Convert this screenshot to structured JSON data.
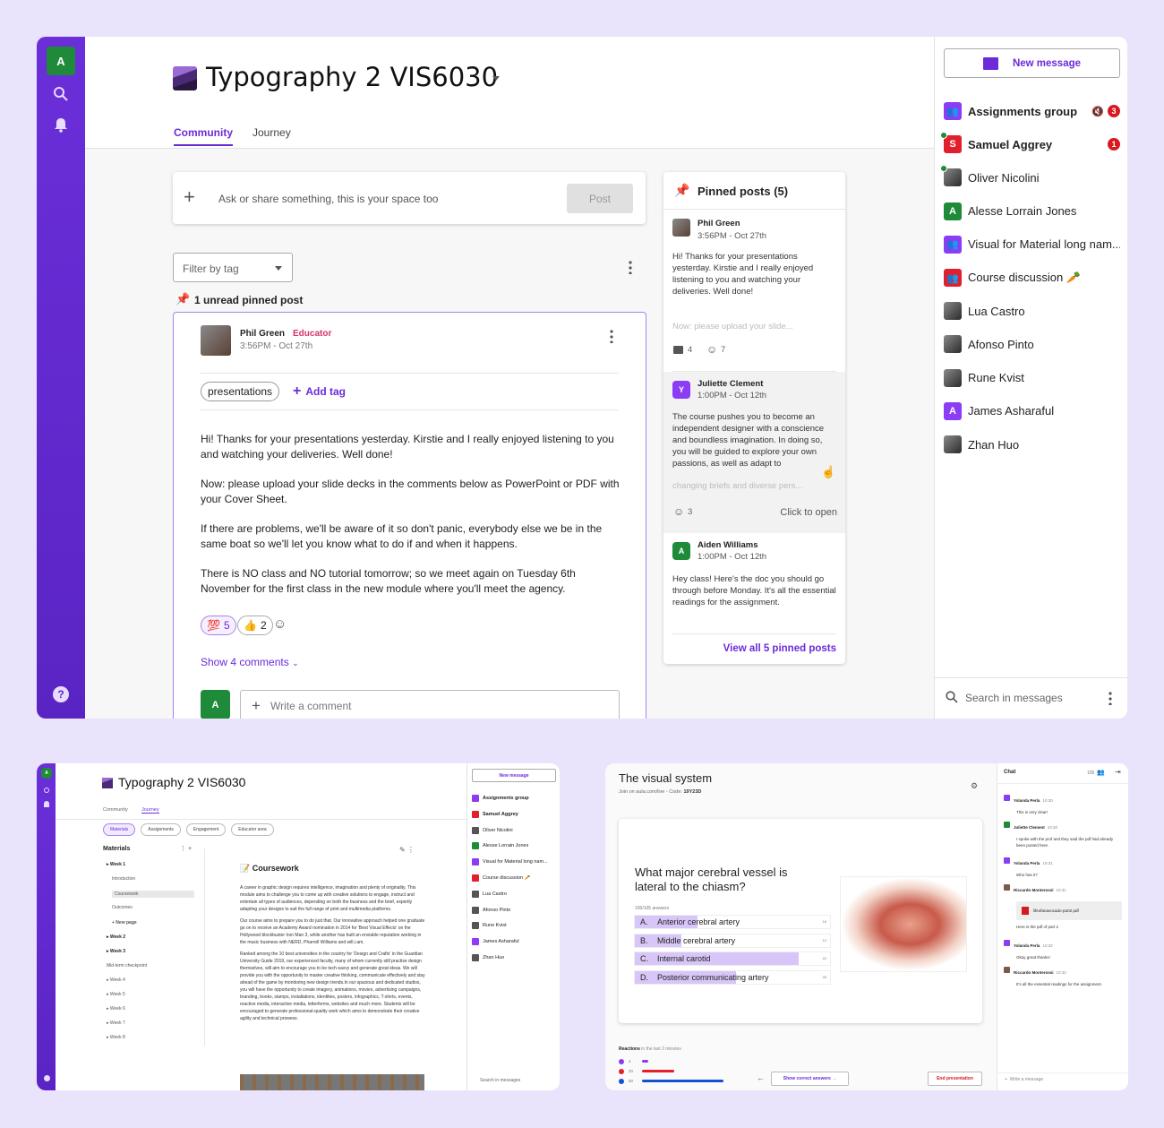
{
  "main": {
    "user_initial": "A",
    "course_title": "Typography 2 VIS6030",
    "tabs": [
      {
        "label": "Community",
        "active": true
      },
      {
        "label": "Journey",
        "active": false
      }
    ],
    "composer": {
      "placeholder": "Ask or share something, this is your space too",
      "post_label": "Post"
    },
    "filter": {
      "placeholder": "Filter by tag"
    },
    "unread_pinned": "1 unread pinned post",
    "post": {
      "author": "Phil Green",
      "role": "Educator",
      "time": "3:56PM - Oct 27th",
      "tags": [
        "presentations"
      ],
      "add_tag": "Add tag",
      "paragraphs": [
        "Hi! Thanks for your presentations yesterday. Kirstie and I really enjoyed listening to you and watching your deliveries. Well done!",
        "Now: please upload your slide decks in the comments below as PowerPoint or PDF with your Cover Sheet.",
        "If there are problems, we'll be aware of it so don't panic, everybody else we be in the same boat so we'll let you know what to do if and when it happens.",
        "There is NO class and NO tutorial tomorrow; so we meet again on Tuesday 6th November for the first class in the new module where you'll meet the agency."
      ],
      "reactions": [
        {
          "emoji": "💯",
          "count": "5"
        },
        {
          "emoji": "👍",
          "count": "2"
        }
      ],
      "show_comments": "Show 4 comments",
      "comment_placeholder": "Write a comment",
      "commenter_initial": "A"
    },
    "pinned": {
      "title": "Pinned posts (5)",
      "items": [
        {
          "author": "Phil Green",
          "time": "3:56PM - Oct 27th",
          "text": "Hi! Thanks for your presentations yesterday. Kirstie and I really enjoyed listening to you and watching your deliveries. Well done!",
          "fade": "Now: please upload your slide...",
          "comments": "4",
          "reactions": "7"
        },
        {
          "author": "Juliette Clement",
          "initial": "Y",
          "time": "1:00PM - Oct 12th",
          "text": "The course pushes you to become an independent designer with a conscience and boundless imagination. In doing so, you will be guided to explore your own passions, as well as adapt to",
          "fade": "changing briefs and diverse pers...",
          "reactions": "3",
          "open": "Click to open"
        },
        {
          "author": "Aiden Williams",
          "initial": "A",
          "time": "1:00PM - Oct 12th",
          "text": "Hey class! Here's the doc you should go through before Monday. It's all the essential readings for the assignment."
        }
      ],
      "view_all": "View all 5 pinned posts"
    }
  },
  "chat": {
    "new_message": "New message",
    "items": [
      {
        "name": "Assignments group",
        "type": "group",
        "color": "#8b3cf5",
        "bold": true,
        "muted": true,
        "badge": "3"
      },
      {
        "name": "Samuel Aggrey",
        "initial": "S",
        "color": "#e0202d",
        "bold": true,
        "online": true,
        "badge": "1"
      },
      {
        "name": "Oliver Nicolini",
        "type": "photo",
        "online": true
      },
      {
        "name": "Alesse Lorrain Jones",
        "initial": "A",
        "color": "#1f8a3a"
      },
      {
        "name": "Visual for Material long nam...",
        "type": "group",
        "color": "#8b3cf5"
      },
      {
        "name": "Course discussion 🥕",
        "type": "group",
        "color": "#e0202d"
      },
      {
        "name": "Lua Castro",
        "type": "photo"
      },
      {
        "name": "Afonso Pinto",
        "type": "photo"
      },
      {
        "name": "Rune Kvist",
        "type": "photo"
      },
      {
        "name": "James Asharaful",
        "initial": "A",
        "color": "#8b3cf5"
      },
      {
        "name": "Zhan Huo",
        "type": "photo"
      }
    ],
    "search_placeholder": "Search in messages"
  },
  "journey": {
    "title": "Typography 2 VIS6030",
    "tabs": [
      "Community",
      "Journey"
    ],
    "chips": [
      "Materials",
      "Assignments",
      "Engagement",
      "Educator area"
    ],
    "materials_title": "Materials",
    "tree": [
      "Week 1",
      "Introduction",
      "Coursework",
      "Outcomes",
      "New page",
      "Week 2",
      "Week 3",
      "Mid-term checkpoint",
      "Week 4",
      "Week 5",
      "Week 6",
      "Week 7",
      "Week 8"
    ],
    "doc_title": "Coursework",
    "doc_paras": [
      "A career in graphic design requires intelligence, imagination and plenty of originality. This module aims to challenge you to come up with creative solutions to engage, instruct and entertain all types of audiences, depending on both the business and the brief, expertly adapting your designs to suit the full range of print and multimedia platforms.",
      "Our course aims to prepare you to do just that. Our innovative approach helped one graduate go on to receive an Academy Award nomination in 2014 for 'Best Visual Effects' on the Hollywood blockbuster Iron Man 3, while another has built an enviable reputation working in the music business with NERD, Pharrell Williams and will.i.am.",
      "Ranked among the 10 best universities in the country for 'Design and Crafts' in the Guardian University Guide 2019, our experienced faculty, many of whom currently still practise design themselves, will aim to encourage you to be tech-savvy and generate great ideas. We will provide you with the opportunity to master creative thinking, communicate effectively and stay ahead of the game by monitoring new design trends.In our spacious and dedicated studios, you will have the opportunity to create imagery, animations, movies, advertising campaigns, branding, books, stamps, installations, identities, posters, infographics, T-shirts, events, reactive media, interactive media, letterforms, websites and much more. Students will be encouraged to generate professional-quality work which aims to demonstrate their creative agility and technical prowess."
    ]
  },
  "live": {
    "title": "The visual system",
    "join": "Join on aula.com/live - Code: ",
    "code": "19Y23D",
    "question": "What major cerebral vessel is lateral to the chiasm?",
    "answers_count": "100/105 answers",
    "options": [
      {
        "letter": "A.",
        "text": "Anterior cerebral artery",
        "votes": 16
      },
      {
        "letter": "B.",
        "text": "Middle cerebral artery",
        "votes": 12
      },
      {
        "letter": "C.",
        "text": "Internal carotid",
        "votes": 42
      },
      {
        "letter": "D.",
        "text": "Posterior communicating artery",
        "votes": 26
      }
    ],
    "reactions_title": "Reactions",
    "reactions_sub": "in the last 2 minutes",
    "reactions": [
      {
        "count": 4,
        "color": "#8b3cf5"
      },
      {
        "count": 20,
        "color": "#e0202d"
      },
      {
        "count": 50,
        "color": "#1450d4"
      }
    ],
    "show_answers": "Show correct answers",
    "end": "End presentation",
    "chat_title": "Chat",
    "participants": "105",
    "messages": [
      {
        "name": "Yolanda Perla",
        "time": "10:30",
        "text": "This is very clear!",
        "initial": "Y",
        "color": "#8b3cf5"
      },
      {
        "name": "Juliette Clement",
        "time": "10:30",
        "text": "I spoke with the prof and they said the pdf had already been posted here.",
        "initial": "J",
        "color": "#1f8a3a"
      },
      {
        "name": "Yolanda Perla",
        "time": "10:31",
        "text": "Who has it?",
        "initial": "Y",
        "color": "#8b3cf5"
      },
      {
        "name": "Riccardo Monterossi",
        "time": "10:31",
        "text": "Here is the pdf of part 2",
        "file": "lifeofanavocado-part2.pdf"
      },
      {
        "name": "Yolanda Perla",
        "time": "10:32",
        "text": "Okay great thanks!",
        "initial": "Y",
        "color": "#8b3cf5"
      },
      {
        "name": "Riccardo Monterossi",
        "time": "10:32",
        "text": "It's all the essential readings for the assignment."
      }
    ],
    "write_placeholder": "Write a message"
  }
}
